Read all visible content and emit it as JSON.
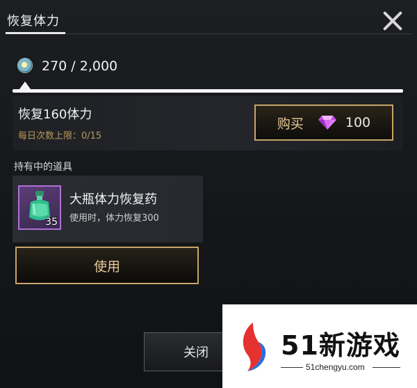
{
  "header": {
    "tab_title": "恢复体力",
    "close_icon": "close-x-icon"
  },
  "stamina": {
    "icon": "stamina-orb-icon",
    "value_text": "270 / 2,000",
    "current": 270,
    "max": 2000
  },
  "recover": {
    "title": "恢复160体力",
    "daily_limit": "每日次数上限：0/15",
    "buy_label": "购买",
    "gem_icon": "purple-diamond-icon",
    "price": "100"
  },
  "inventory": {
    "section_label": "持有中的道具",
    "item": {
      "name": "大瓶体力恢复药",
      "description": "使用时，体力恢复300",
      "count": "35",
      "icon": "green-potion-bottle-icon"
    },
    "use_label": "使用"
  },
  "footer": {
    "close_label": "关闭"
  },
  "watermark": {
    "brand": "51新游戏",
    "url": "51chengyu.com"
  },
  "colors": {
    "gold_border": "#c9a46a",
    "gold_text": "#e8c999",
    "rare_purple": "#b06fd6",
    "background": "#131518"
  }
}
